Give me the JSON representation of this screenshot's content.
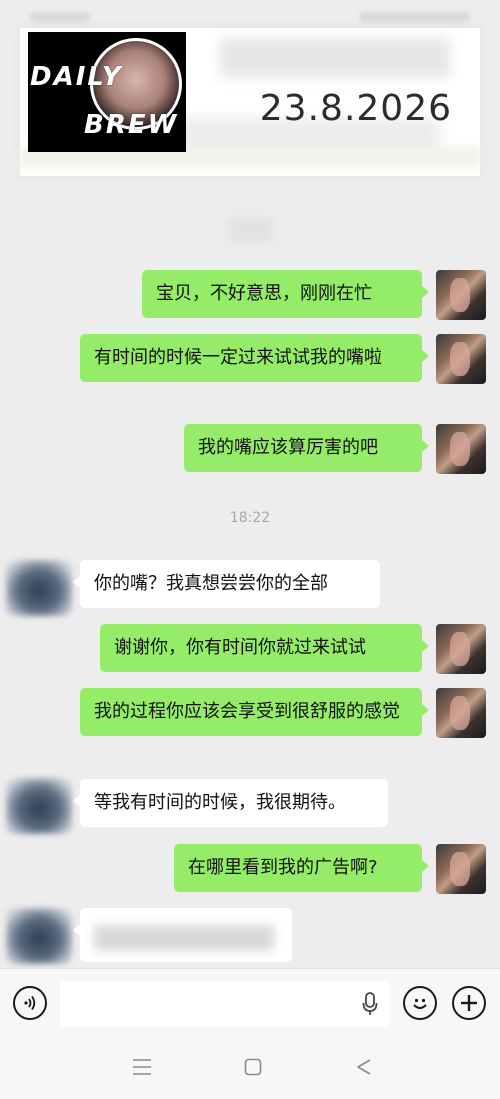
{
  "banner": {
    "logo_line1": "DAILY",
    "logo_line2": "BREW",
    "date": "23.8.2026"
  },
  "chat": {
    "time_separator": "18:22",
    "messages": [
      {
        "from": "me",
        "text": "宝贝，不好意思，刚刚在忙"
      },
      {
        "from": "me",
        "text": "有时间的时候一定过来试试我的嘴啦"
      },
      {
        "from": "me",
        "text": "我的嘴应该算厉害的吧"
      },
      {
        "from": "them",
        "text": "你的嘴？我真想尝尝你的全部"
      },
      {
        "from": "me",
        "text": "谢谢你，你有时间你就过来试试"
      },
      {
        "from": "me",
        "text": "我的过程你应该会享受到很舒服的感觉"
      },
      {
        "from": "them",
        "text": "等我有时间的时候，我很期待。"
      },
      {
        "from": "me",
        "text": "在哪里看到我的广告啊?"
      }
    ]
  },
  "input_bar": {
    "voice_icon": "voice-icon",
    "mic_icon": "microphone-icon",
    "emoji_icon": "emoji-icon",
    "plus_icon": "plus-icon"
  },
  "nav": {
    "menu_icon": "menu-icon",
    "home_icon": "home-icon",
    "back_icon": "back-icon"
  },
  "colors": {
    "my_bubble": "#95ec69",
    "their_bubble": "#ffffff",
    "background": "#ededed"
  }
}
